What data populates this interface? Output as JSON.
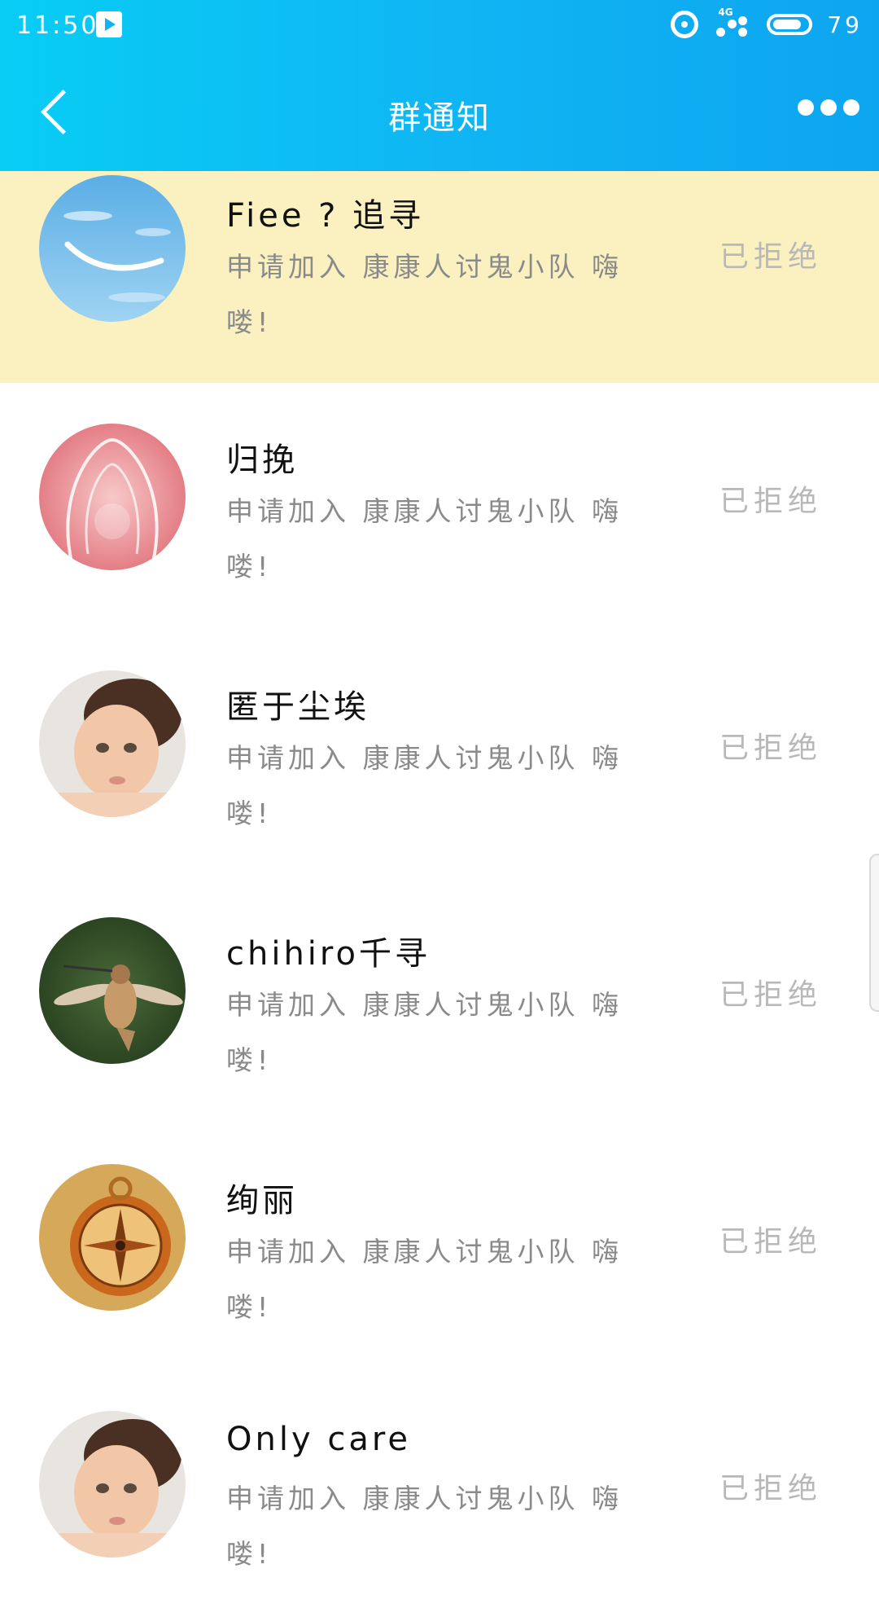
{
  "status_bar": {
    "time": "11:50",
    "network": "4G",
    "battery": "79"
  },
  "nav": {
    "title": "群通知"
  },
  "colors": {
    "header_gradient_start": "#08cdf5",
    "header_gradient_end": "#0da5f0",
    "highlight_row": "#fbf0c0",
    "message_text": "#8a8a8a",
    "status_text": "#b8b8b8"
  },
  "notifications": [
    {
      "name": "Fiee ? 追寻",
      "message": "申请加入 康康人讨鬼小队 嗨喽!",
      "status": "已拒绝",
      "avatar": "sky-smile-avatar"
    },
    {
      "name": "归挽",
      "message": "申请加入 康康人讨鬼小队 嗨喽!",
      "status": "已拒绝",
      "avatar": "pink-light-avatar"
    },
    {
      "name": "匿于尘埃",
      "message": "申请加入 康康人讨鬼小队 嗨喽!",
      "status": "已拒绝",
      "avatar": "baby-avatar"
    },
    {
      "name": "chihiro千寻",
      "message": "申请加入 康康人讨鬼小队 嗨喽!",
      "status": "已拒绝",
      "avatar": "hummingbird-avatar"
    },
    {
      "name": "绚丽",
      "message": "申请加入 康康人讨鬼小队 嗨喽!",
      "status": "已拒绝",
      "avatar": "compass-avatar"
    },
    {
      "name": "Only care",
      "message": "申请加入 康康人讨鬼小队 嗨喽!",
      "status": "已拒绝",
      "avatar": "baby-avatar"
    }
  ]
}
